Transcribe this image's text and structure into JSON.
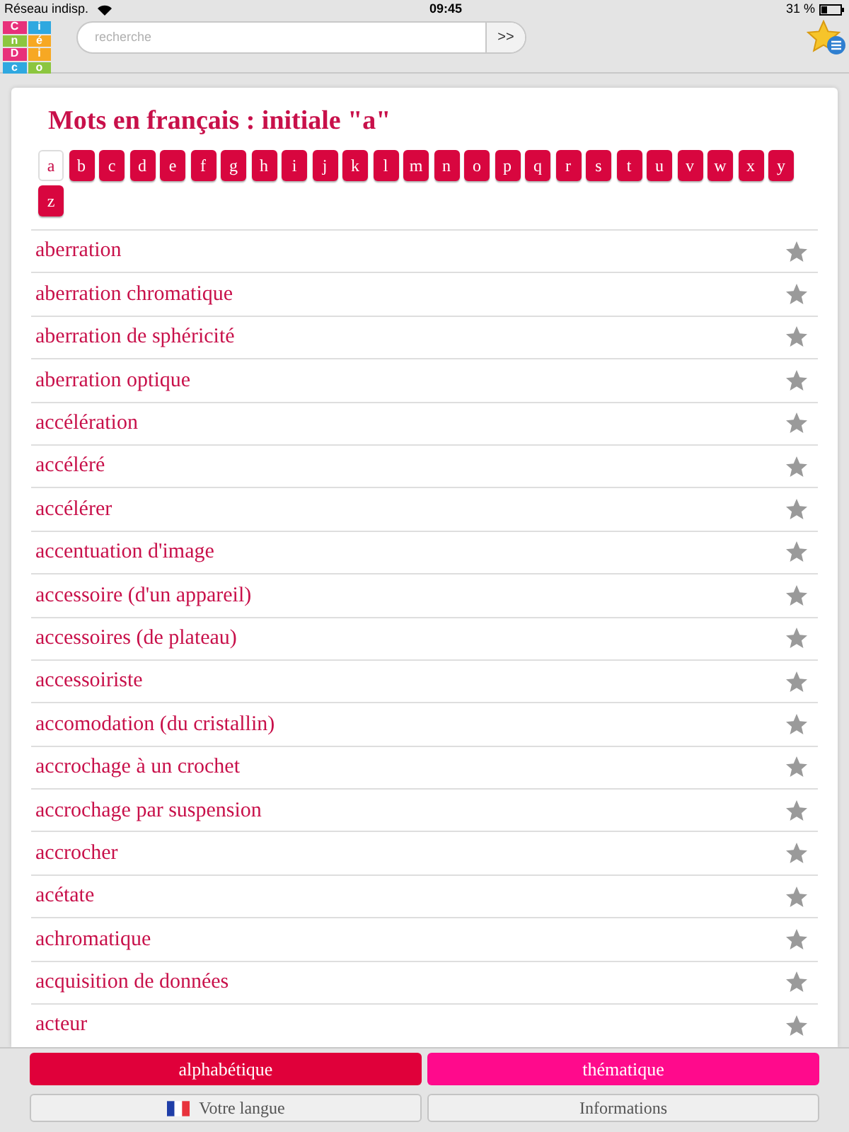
{
  "status_bar": {
    "carrier": "Réseau indisp.",
    "time": "09:45",
    "battery": "31 %"
  },
  "logo": {
    "letters": [
      {
        "char": "C",
        "color": "#e8307a"
      },
      {
        "char": "i",
        "color": "#2fa8e0"
      },
      {
        "char": "n",
        "color": "#8cc63f"
      },
      {
        "char": "é",
        "color": "#f7a823"
      },
      {
        "char": "D",
        "color": "#e8307a"
      },
      {
        "char": "i",
        "color": "#f7a823"
      },
      {
        "char": "c",
        "color": "#2fa8e0"
      },
      {
        "char": "o",
        "color": "#8cc63f"
      }
    ]
  },
  "search": {
    "placeholder": "recherche",
    "button": ">>"
  },
  "title": "Mots en français : initiale \"a\"",
  "letters": [
    {
      "label": "a",
      "selected": true
    },
    {
      "label": "b",
      "selected": false
    },
    {
      "label": "c",
      "selected": false
    },
    {
      "label": "d",
      "selected": false
    },
    {
      "label": "e",
      "selected": false
    },
    {
      "label": "f",
      "selected": false
    },
    {
      "label": "g",
      "selected": false
    },
    {
      "label": "h",
      "selected": false
    },
    {
      "label": "i",
      "selected": false
    },
    {
      "label": "j",
      "selected": false
    },
    {
      "label": "k",
      "selected": false
    },
    {
      "label": "l",
      "selected": false
    },
    {
      "label": "m",
      "selected": false
    },
    {
      "label": "n",
      "selected": false
    },
    {
      "label": "o",
      "selected": false
    },
    {
      "label": "p",
      "selected": false
    },
    {
      "label": "q",
      "selected": false
    },
    {
      "label": "r",
      "selected": false
    },
    {
      "label": "s",
      "selected": false
    },
    {
      "label": "t",
      "selected": false
    },
    {
      "label": "u",
      "selected": false
    },
    {
      "label": "v",
      "selected": false
    },
    {
      "label": "w",
      "selected": false
    },
    {
      "label": "x",
      "selected": false
    },
    {
      "label": "y",
      "selected": false
    },
    {
      "label": "z",
      "selected": false
    }
  ],
  "words": [
    "aberration",
    "aberration chromatique",
    "aberration de sphéricité",
    "aberration optique",
    "accélération",
    "accéléré",
    "accélérer",
    "accentuation d'image",
    "accessoire (d'un appareil)",
    "accessoires (de plateau)",
    "accessoiriste",
    "accomodation (du cristallin)",
    "accrochage à un crochet",
    "accrochage par suspension",
    "accrocher",
    "acétate",
    "achromatique",
    "acquisition de données",
    "acteur"
  ],
  "tabs": [
    {
      "label": "alphabétique",
      "selected": true
    },
    {
      "label": "thématique",
      "selected": false
    }
  ],
  "bottom_buttons": [
    {
      "label": "Votre langue",
      "kind": "flag"
    },
    {
      "label": "Informations",
      "kind": "plain"
    }
  ]
}
